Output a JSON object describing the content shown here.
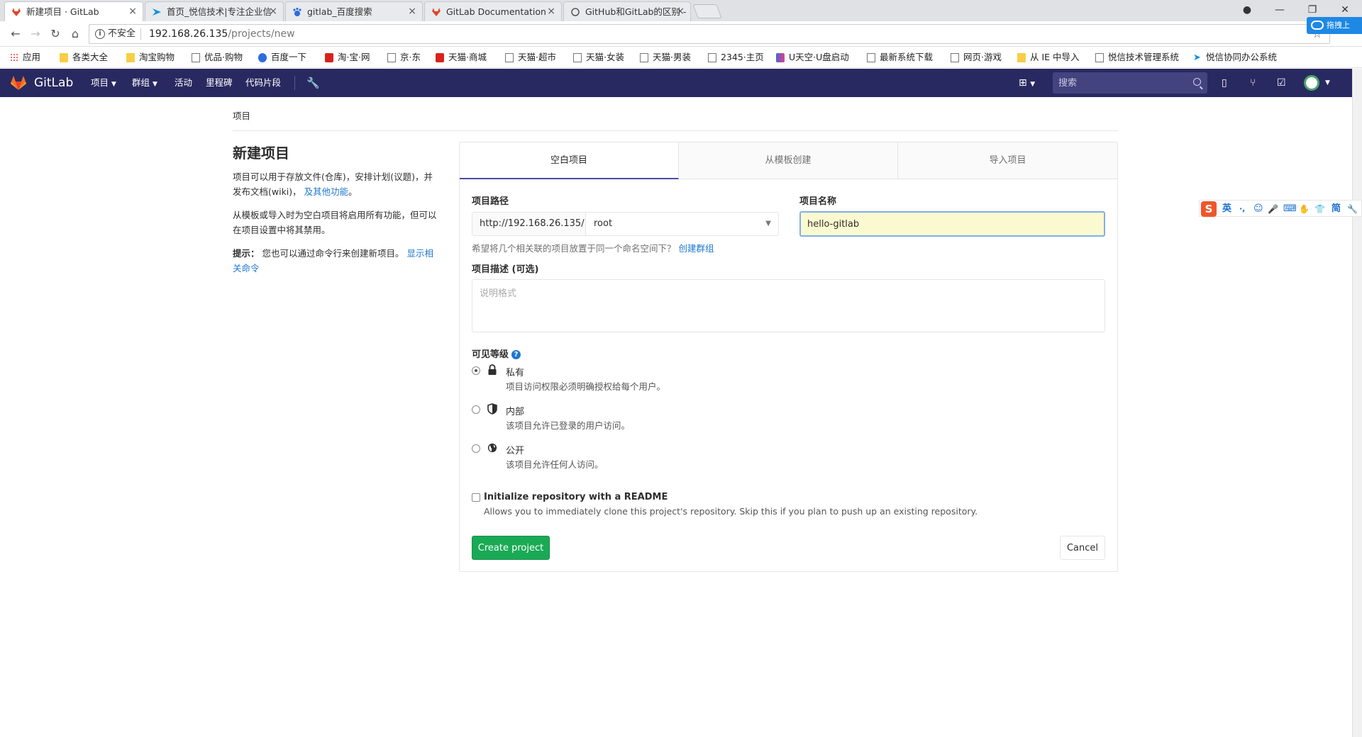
{
  "browser": {
    "tabs": [
      {
        "title": "新建项目 · GitLab",
        "active": true
      },
      {
        "title": "首页_悦信技术|专注企业信",
        "active": false
      },
      {
        "title": "gitlab_百度搜索",
        "active": false
      },
      {
        "title": "GitLab Documentation",
        "active": false
      },
      {
        "title": "GitHub和GitLab的区别 - ",
        "active": false
      }
    ],
    "insecure_label": "不安全",
    "url_host": "192.168.26.135",
    "url_path": "/projects/new",
    "bookmarks": [
      "应用",
      "各类大全",
      "淘宝购物",
      "优品·购物",
      "百度一下",
      "淘·宝·网",
      "京·东",
      "天猫·商城",
      "天猫·超市",
      "天猫·女装",
      "天猫·男装",
      "2345·主页",
      "U天空·U盘启动",
      "最新系统下载",
      "网页·游戏",
      "从 IE 中导入",
      "悦信技术管理系统",
      "悦信协同办公系统"
    ]
  },
  "extension_badge": "拖拽上",
  "gitlab": {
    "brand": "GitLab",
    "nav": [
      "项目",
      "群组",
      "活动",
      "里程碑",
      "代码片段"
    ],
    "search_placeholder": "搜索"
  },
  "page": {
    "breadcrumb": "项目",
    "title": "新建项目",
    "intro_1": "项目可以用于存放文件(仓库)，安排计划(议题)，并发布文档(wiki)，",
    "intro_link": "及其他功能",
    "intro_end": "。",
    "intro_2": "从模板或导入时为空白项目将启用所有功能，但可以在项目设置中将其禁用。",
    "tip_label": "提示：",
    "tip_text": "您也可以通过命令行来创建新项目。",
    "tip_link": "显示相关命令"
  },
  "form": {
    "tabs": [
      "空白项目",
      "从模板创建",
      "导入项目"
    ],
    "path_label": "项目路径",
    "path_prefix": "http://192.168.26.135/",
    "namespace": "root",
    "name_label": "项目名称",
    "name_value": "hello-gitlab",
    "helper_text": "希望将几个相关联的项目放置于同一个命名空间下？",
    "helper_link": "创建群组",
    "desc_label": "项目描述 (可选)",
    "desc_placeholder": "说明格式",
    "visibility_label": "可见等级",
    "visibility": [
      {
        "title": "私有",
        "desc": "项目访问权限必须明确授权给每个用户。",
        "checked": true,
        "icon": "lock-icon"
      },
      {
        "title": "内部",
        "desc": "该项目允许已登录的用户访问。",
        "checked": false,
        "icon": "shield-icon"
      },
      {
        "title": "公开",
        "desc": "该项目允许任何人访问。",
        "checked": false,
        "icon": "globe-icon"
      }
    ],
    "readme_title": "Initialize repository with a README",
    "readme_desc": "Allows you to immediately clone this project's repository. Skip this if you plan to push up an existing repository.",
    "create_label": "Create project",
    "cancel_label": "Cancel"
  },
  "ime": {
    "logo": "S",
    "items": [
      "英",
      "·,",
      "☺",
      "🎤",
      "⌨",
      "✋",
      "👕",
      "简",
      "🔧"
    ]
  },
  "colors": {
    "header": "#292961",
    "accent": "#4b4ba3",
    "success": "#1aaa55",
    "link": "#1f78d1"
  }
}
